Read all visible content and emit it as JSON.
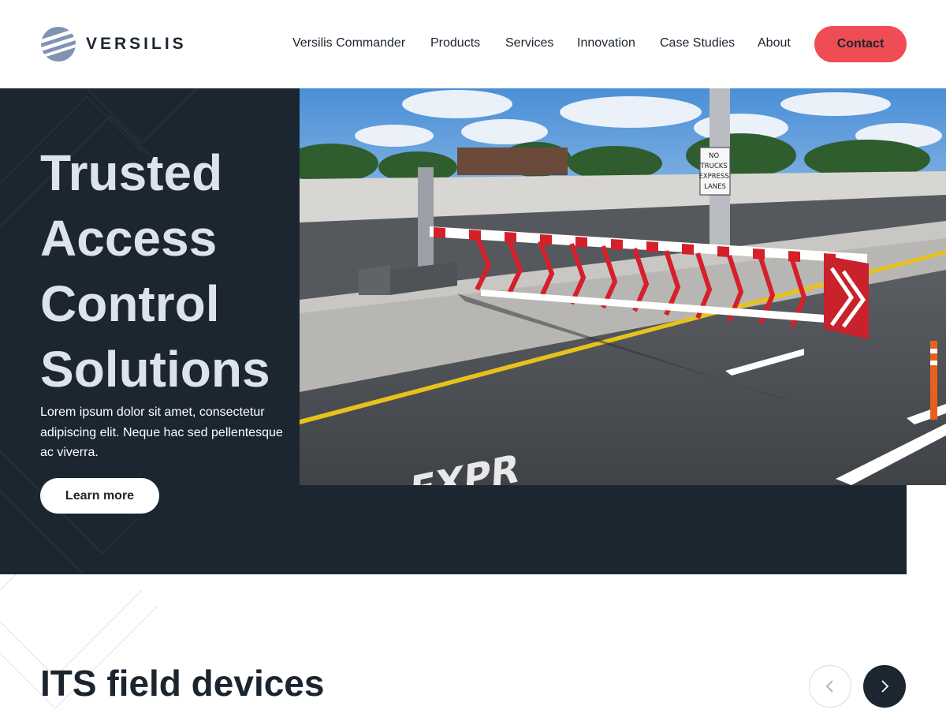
{
  "header": {
    "logo_text": "VERSILIS",
    "nav": [
      {
        "label": "Versilis Commander"
      },
      {
        "label": "Products"
      },
      {
        "label": "Services"
      },
      {
        "label": "Innovation"
      },
      {
        "label": "Case Studies"
      },
      {
        "label": "About"
      }
    ],
    "contact_label": "Contact"
  },
  "hero": {
    "title_lines": [
      "Trusted",
      "Access",
      "Control",
      "Solutions"
    ],
    "description": "Lorem ipsum dolor sit amet, consectetur adipiscing elit. Neque hac sed pellentesque ac viverra.",
    "cta_label": "Learn more",
    "image": {
      "sign_lines": [
        "NO",
        "TRUCKS",
        "EXPRESS",
        "LANES"
      ],
      "road_text": "EXPR"
    }
  },
  "section": {
    "title": "ITS field devices",
    "prev_icon": "chevron-left-icon",
    "next_icon": "chevron-right-icon"
  },
  "colors": {
    "brand_dark": "#1b2631",
    "accent_red": "#ef4c55",
    "hero_title": "#dde3ee",
    "logo_blue": "#7d8fb0"
  }
}
